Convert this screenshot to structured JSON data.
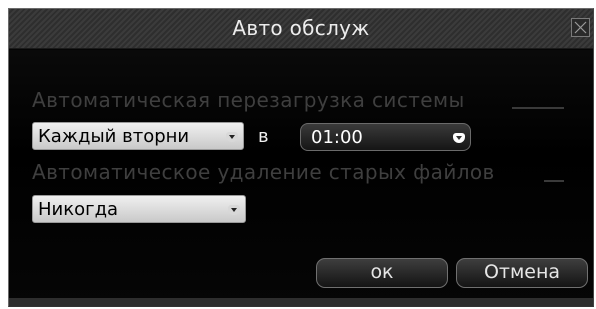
{
  "dialog": {
    "title": "Авто обслуж"
  },
  "reboot": {
    "label": "Автоматическая перезагрузка системы",
    "day_value": "Каждый вторни",
    "at_label": "в",
    "time_value": "01:00"
  },
  "cleanup": {
    "label": "Автоматическое удаление старых файлов",
    "value": "Никогда"
  },
  "buttons": {
    "ok_label": "ок",
    "cancel_label": "Отмена"
  }
}
